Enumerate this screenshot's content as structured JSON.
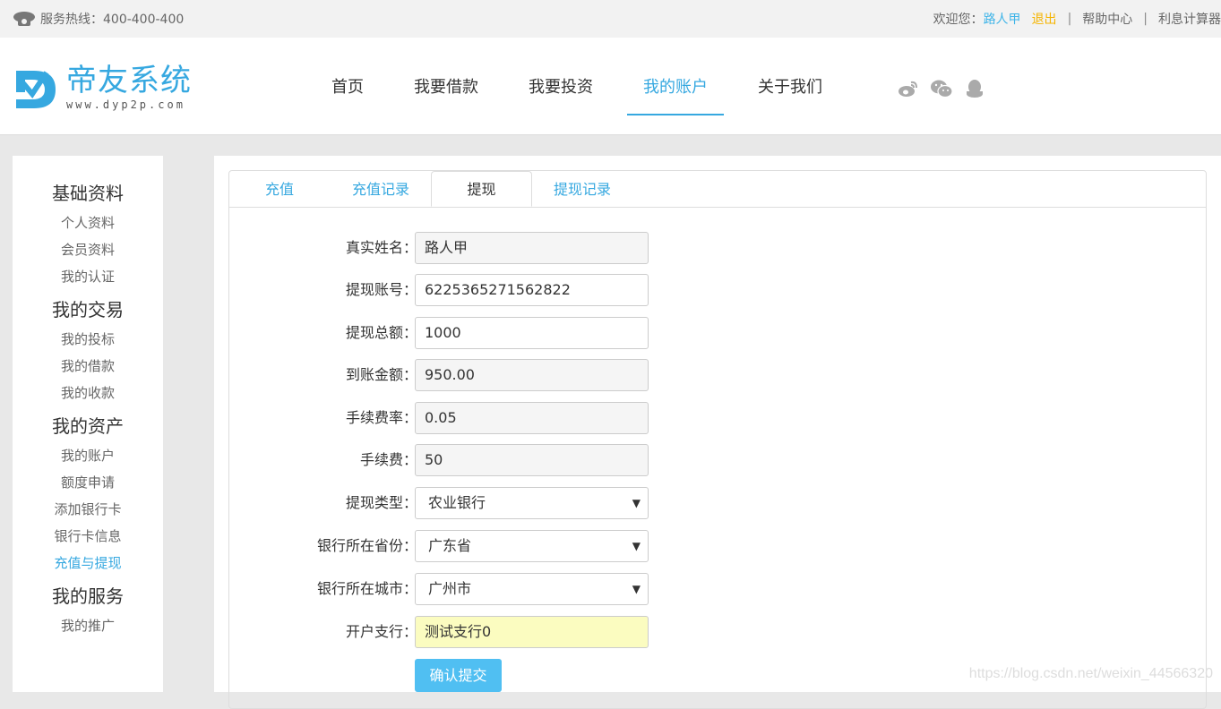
{
  "topbar": {
    "hotline": "服务热线：400-400-400",
    "welcome": "欢迎您：",
    "username": "路人甲",
    "logout": "退出",
    "help": "帮助中心",
    "calculator": "利息计算器",
    "separator": "|"
  },
  "logo": {
    "title": "帝友系统",
    "url": "www.dyp2p.com"
  },
  "nav": {
    "items": [
      {
        "label": "首页"
      },
      {
        "label": "我要借款"
      },
      {
        "label": "我要投资"
      },
      {
        "label": "我的账户"
      },
      {
        "label": "关于我们"
      }
    ],
    "active_index": 3
  },
  "sidebar": {
    "groups": [
      {
        "title": "基础资料",
        "items": [
          "个人资料",
          "会员资料",
          "我的认证"
        ]
      },
      {
        "title": "我的交易",
        "items": [
          "我的投标",
          "我的借款",
          "我的收款"
        ]
      },
      {
        "title": "我的资产",
        "items": [
          "我的账户",
          "额度申请",
          "添加银行卡",
          "银行卡信息",
          "充值与提现"
        ]
      },
      {
        "title": "我的服务",
        "items": [
          "我的推广"
        ]
      }
    ],
    "active_item": "充值与提现"
  },
  "tabs": {
    "items": [
      "充值",
      "充值记录",
      "提现",
      "提现记录"
    ],
    "active_index": 2
  },
  "form": {
    "real_name": {
      "label": "真实姓名：",
      "value": "路人甲"
    },
    "account": {
      "label": "提现账号：",
      "value": "6225365271562822"
    },
    "total": {
      "label": "提现总额：",
      "value": "1000"
    },
    "received": {
      "label": "到账金额：",
      "value": "950.00"
    },
    "fee_rate": {
      "label": "手续费率：",
      "value": "0.05"
    },
    "fee": {
      "label": "手续费：",
      "value": "50"
    },
    "type": {
      "label": "提现类型：",
      "value": "农业银行"
    },
    "province": {
      "label": "银行所在省份：",
      "value": "广东省"
    },
    "city": {
      "label": "银行所在城市：",
      "value": "广州市"
    },
    "branch": {
      "label": "开户支行：",
      "value": "测试支行0"
    },
    "submit": "确认提交"
  },
  "watermark": "https://blog.csdn.net/weixin_44566320",
  "colors": {
    "accent": "#36a8e0",
    "logout": "#f5b400",
    "button": "#50bff2"
  }
}
